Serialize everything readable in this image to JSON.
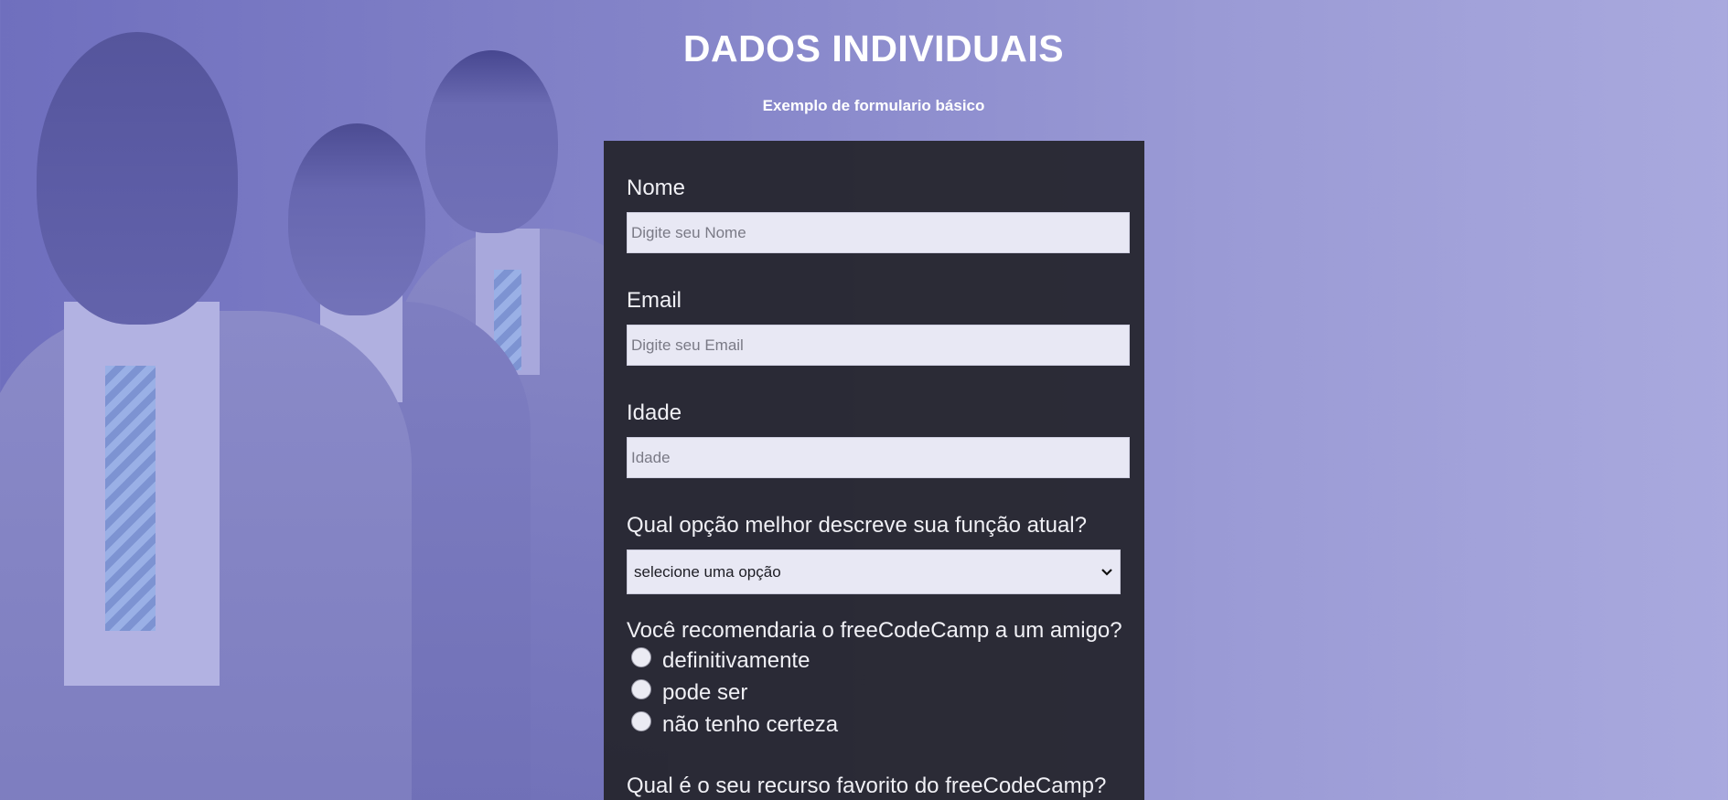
{
  "page": {
    "title": "DADOS INDIVIDUAIS",
    "subtitle": "Exemplo de formulario básico"
  },
  "form": {
    "name": {
      "label": "Nome",
      "placeholder": "Digite seu Nome"
    },
    "email": {
      "label": "Email",
      "placeholder": "Digite seu Email"
    },
    "age": {
      "label": "Idade",
      "placeholder": "Idade"
    },
    "role": {
      "label": "Qual opção melhor descreve sua função atual?",
      "selected": "selecione uma opção"
    },
    "recommend": {
      "label": "Você recomendaria o freeCodeCamp a um amigo?",
      "options": [
        "definitivamente",
        "pode ser",
        "não tenho certeza"
      ]
    },
    "favorite": {
      "label": "Qual é o seu recurso favorito do freeCodeCamp?"
    }
  },
  "colors": {
    "panel": "#262630",
    "background_start": "#6f6fbe",
    "background_end": "#a9a9de",
    "input_background": "#e8e8f4"
  },
  "icons": {
    "select_chevron": "chevron-down-icon"
  }
}
